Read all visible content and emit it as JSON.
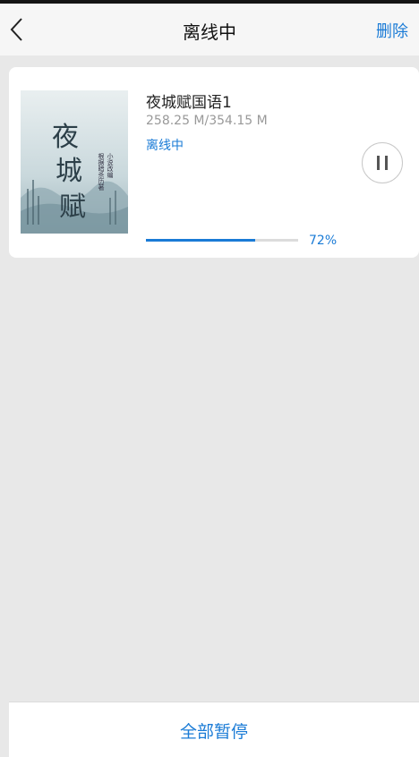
{
  "header": {
    "title": "离线中",
    "delete_label": "删除"
  },
  "download": {
    "title": "夜城赋国语1",
    "size": "258.25 M/354.15 M",
    "status": "离线中",
    "progress_fraction": 0.72,
    "progress_text": "72%",
    "cover": {
      "title_text": "夜城赋",
      "subtitle_text": "根据暗杀历著 小说改编"
    }
  },
  "footer": {
    "pause_all_label": "全部暂停"
  },
  "colors": {
    "accent": "#1a7bd6",
    "background": "#e8e8e8"
  }
}
